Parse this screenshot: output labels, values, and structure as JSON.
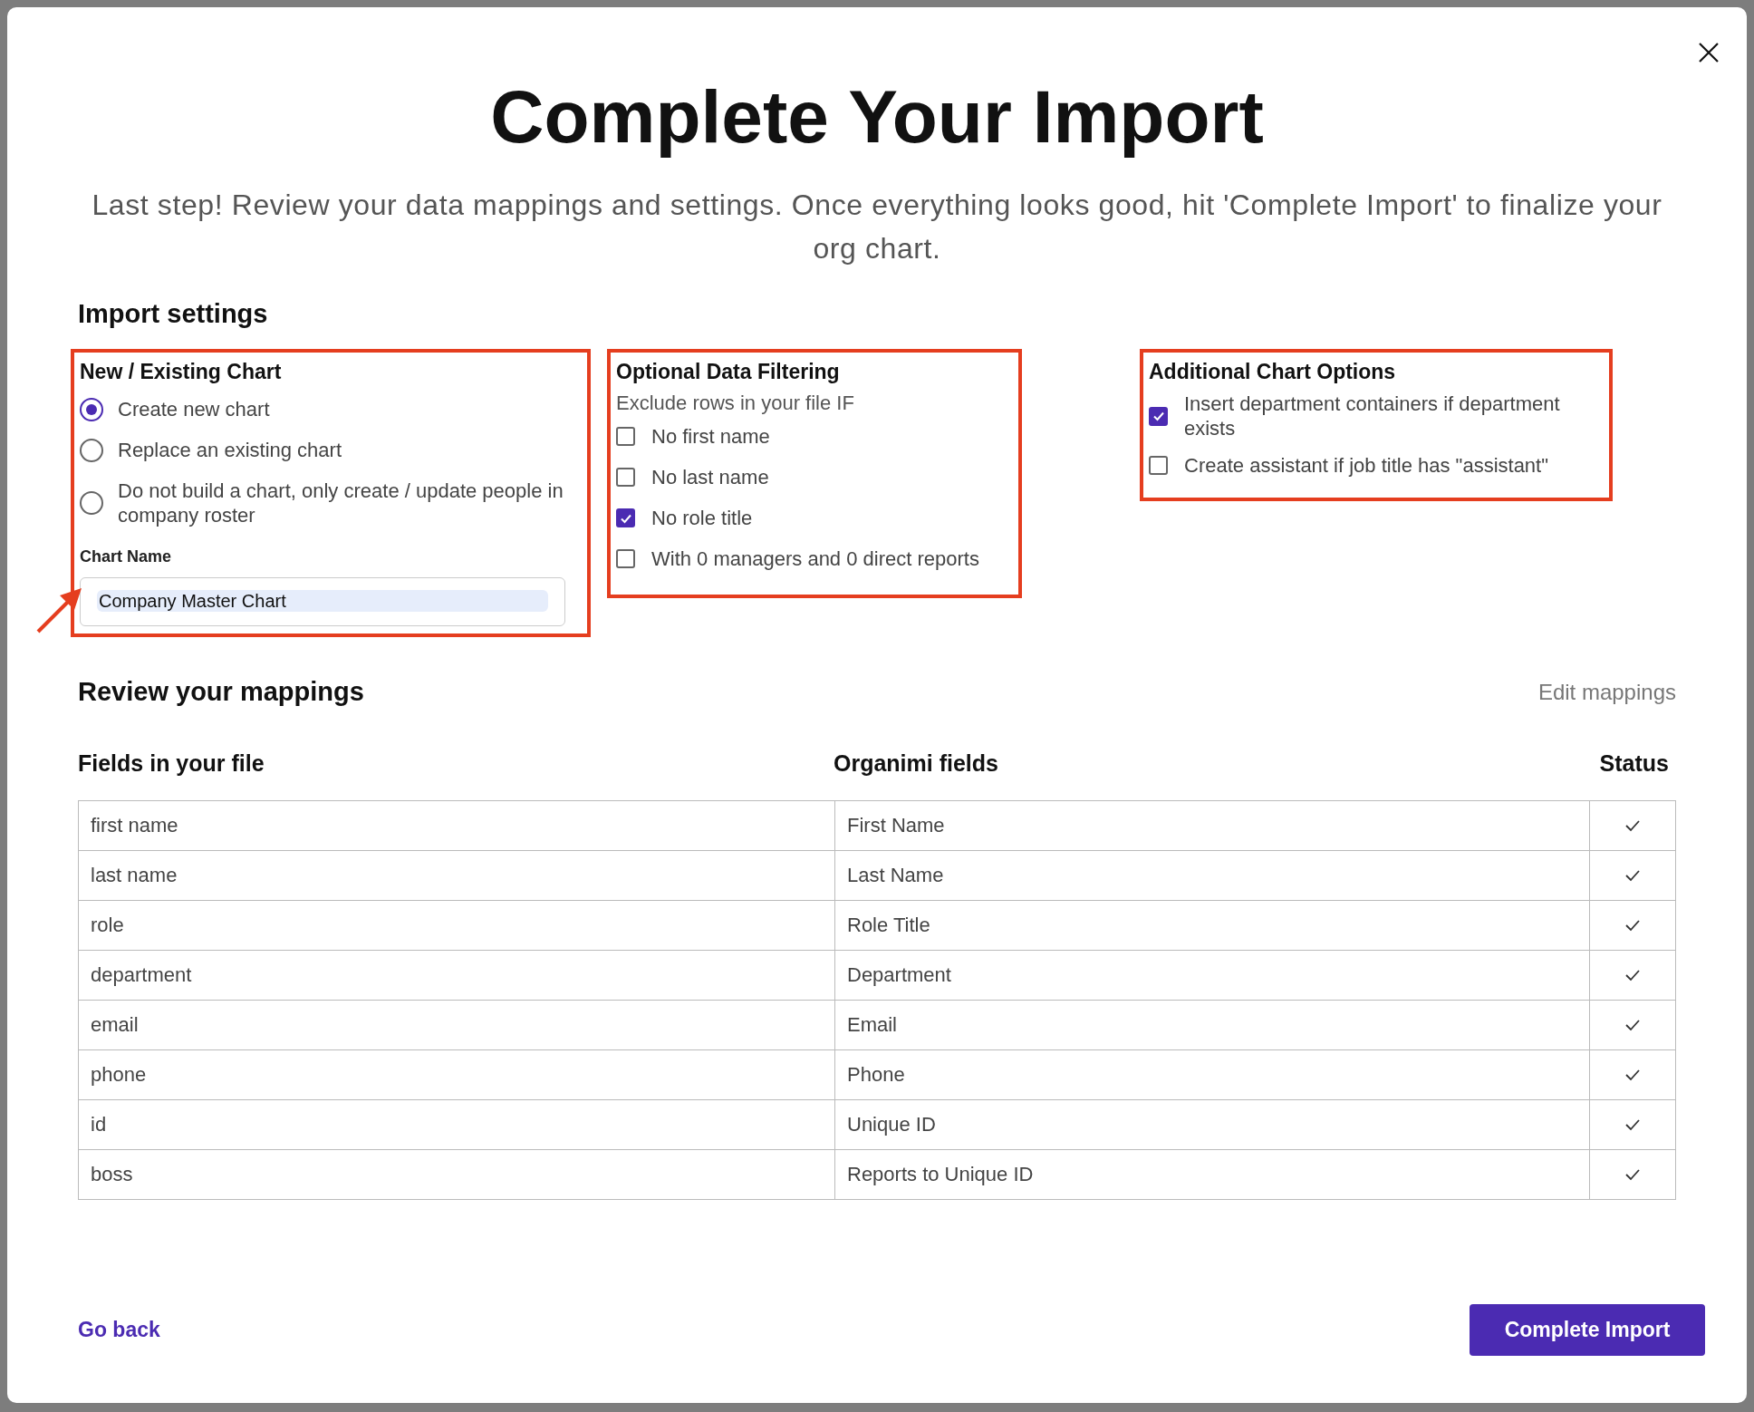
{
  "dialog": {
    "title": "Complete Your Import",
    "subtitle": "Last step! Review your data mappings and settings. Once everything looks good, hit 'Complete Import' to finalize your org chart."
  },
  "import_settings": {
    "heading": "Import settings",
    "chart_choice": {
      "heading": "New / Existing Chart",
      "options": [
        {
          "label": "Create new chart",
          "selected": true
        },
        {
          "label": "Replace an existing chart",
          "selected": false
        },
        {
          "label": "Do not build a chart, only create / update people in company roster",
          "selected": false
        }
      ],
      "chart_name": {
        "label": "Chart Name",
        "value": "Company Master Chart"
      }
    },
    "filtering": {
      "heading": "Optional Data Filtering",
      "intro": "Exclude rows in your file IF",
      "options": [
        {
          "label": "No first name",
          "checked": false
        },
        {
          "label": "No last name",
          "checked": false
        },
        {
          "label": "No role title",
          "checked": true
        },
        {
          "label": "With 0 managers and 0 direct reports",
          "checked": false
        }
      ]
    },
    "chart_options": {
      "heading": "Additional Chart Options",
      "options": [
        {
          "label": "Insert department containers if department exists",
          "checked": true
        },
        {
          "label": "Create assistant if job title has \"assistant\"",
          "checked": false
        }
      ]
    }
  },
  "mappings": {
    "heading": "Review your mappings",
    "edit_link": "Edit mappings",
    "columns": [
      "Fields in your file",
      "Organimi fields",
      "Status"
    ],
    "rows": [
      {
        "file_field": "first name",
        "organimi_field": "First Name",
        "mapped": true
      },
      {
        "file_field": "last name",
        "organimi_field": "Last Name",
        "mapped": true
      },
      {
        "file_field": "role",
        "organimi_field": "Role Title",
        "mapped": true
      },
      {
        "file_field": "department",
        "organimi_field": "Department",
        "mapped": true
      },
      {
        "file_field": "email",
        "organimi_field": "Email",
        "mapped": true
      },
      {
        "file_field": "phone",
        "organimi_field": "Phone",
        "mapped": true
      },
      {
        "file_field": "id",
        "organimi_field": "Unique ID",
        "mapped": true
      },
      {
        "file_field": "boss",
        "organimi_field": "Reports to Unique ID",
        "mapped": true
      }
    ]
  },
  "footer": {
    "back": "Go back",
    "submit": "Complete Import"
  }
}
